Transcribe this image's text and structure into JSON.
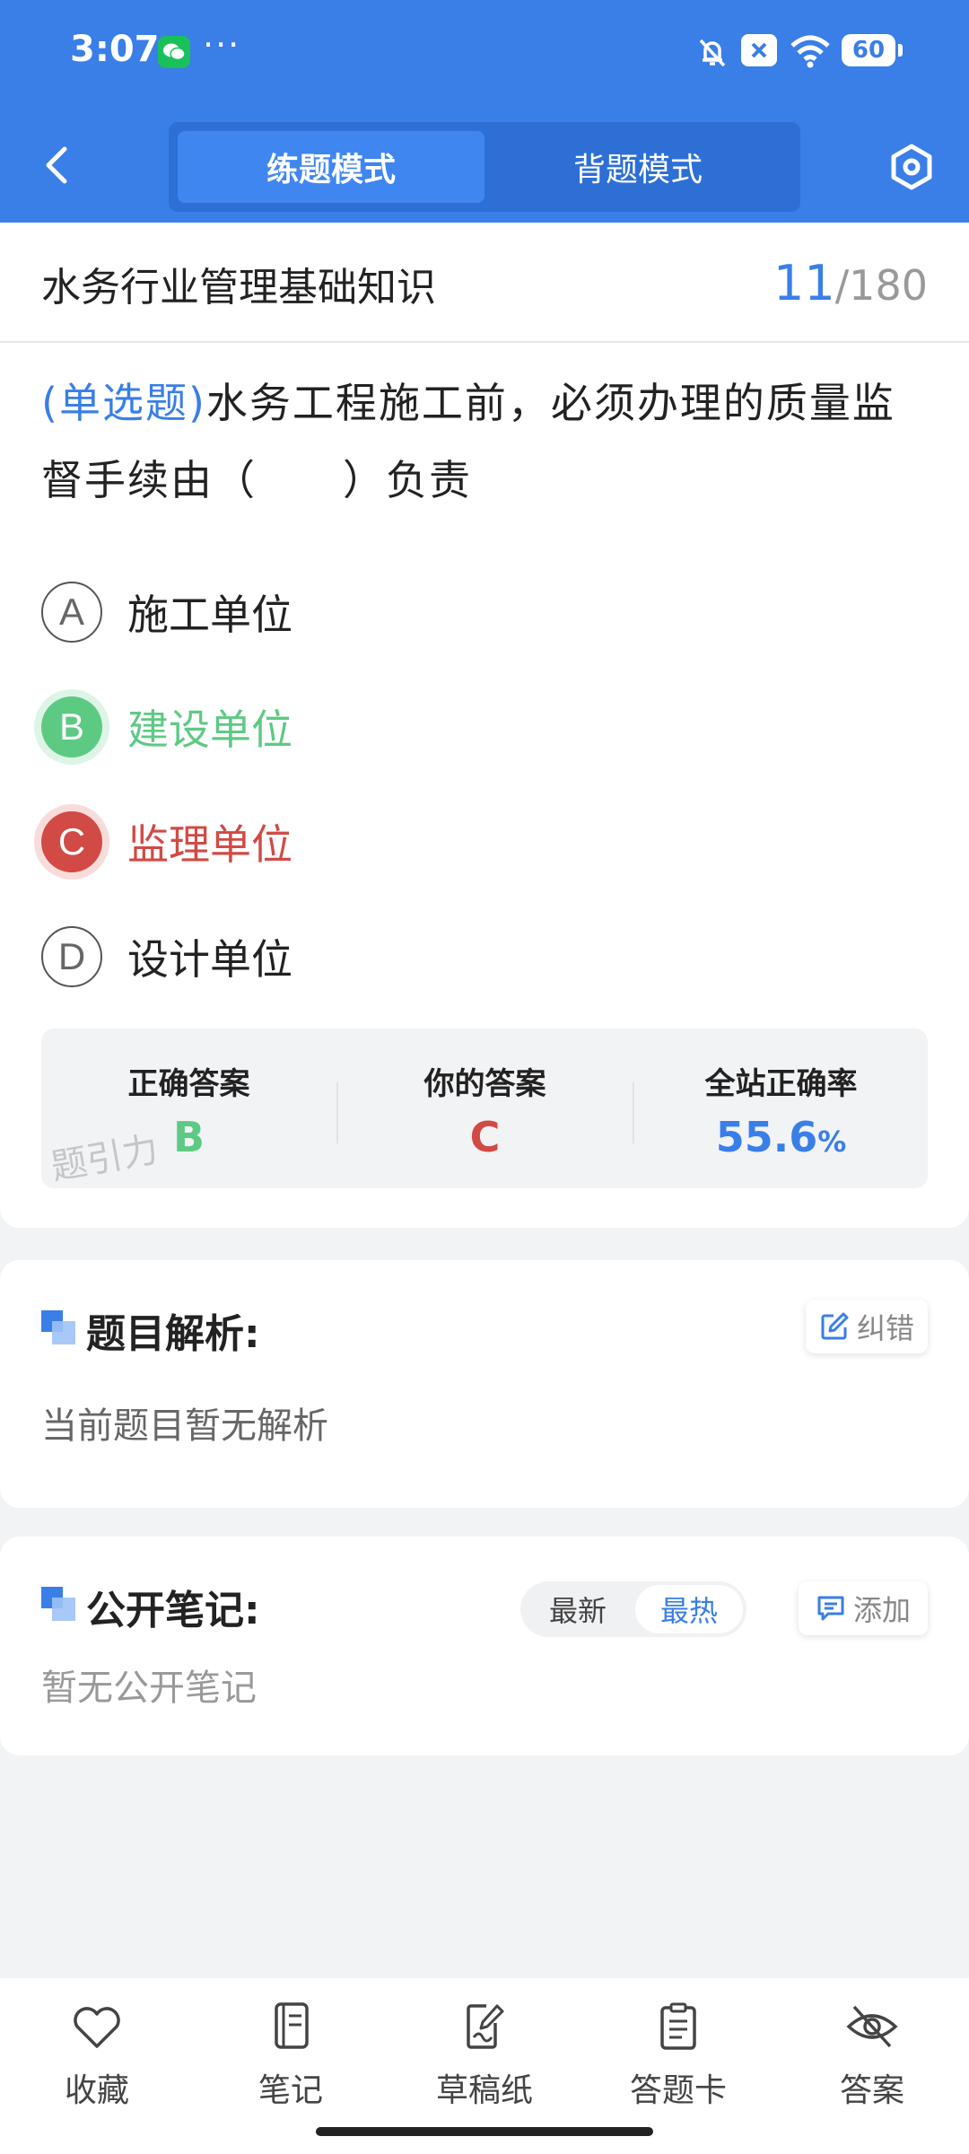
{
  "status_bar": {
    "time": "3:07",
    "dots": "···",
    "battery": "60"
  },
  "header": {
    "modes": [
      "练题模式",
      "背题模式"
    ],
    "active_mode": "练题模式"
  },
  "subject": {
    "title": "水务行业管理基础知识",
    "current": "11",
    "total": "/180"
  },
  "question": {
    "type_label": "(单选题)",
    "text": "水务工程施工前，必须办理的质量监督手续由（　　）负责"
  },
  "options": [
    {
      "letter": "A",
      "text": "施工单位",
      "state": "normal"
    },
    {
      "letter": "B",
      "text": "建设单位",
      "state": "correct"
    },
    {
      "letter": "C",
      "text": "监理单位",
      "state": "wrong"
    },
    {
      "letter": "D",
      "text": "设计单位",
      "state": "normal"
    }
  ],
  "answer_summary": {
    "correct_label": "正确答案",
    "correct_value": "B",
    "yours_label": "你的答案",
    "yours_value": "C",
    "rate_label": "全站正确率",
    "rate_value": "55.6",
    "rate_unit": "%",
    "watermark": "题引力"
  },
  "analysis": {
    "title": "题目解析:",
    "fix_label": "纠错",
    "body": "当前题目暂无解析"
  },
  "notes": {
    "title": "公开笔记:",
    "sort_options": [
      "最新",
      "最热"
    ],
    "active_sort": "最热",
    "add_label": "添加",
    "body": "暂无公开笔记"
  },
  "toolbar": {
    "items": [
      {
        "label": "收藏",
        "icon": "heart-icon"
      },
      {
        "label": "笔记",
        "icon": "notebook-icon"
      },
      {
        "label": "草稿纸",
        "icon": "draft-paper-icon"
      },
      {
        "label": "答题卡",
        "icon": "answer-sheet-icon"
      },
      {
        "label": "答案",
        "icon": "eye-off-icon"
      }
    ]
  },
  "colors": {
    "primary": "#3a7ee8",
    "correct": "#5dca83",
    "wrong": "#d24a45"
  }
}
